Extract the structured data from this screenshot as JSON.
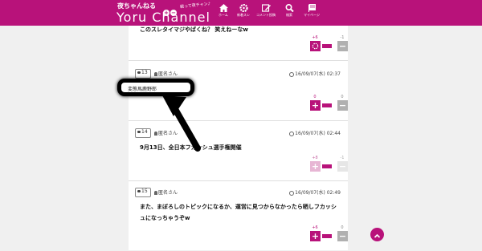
{
  "header": {
    "logo_jp": "夜ちゃんねる",
    "logo_en": "Yoru Channel",
    "logo_tag": "戦って夜チャン♪",
    "logo_plus": "+",
    "logo_minus": "−",
    "nav": [
      {
        "label": "ホーム",
        "icon": "home-icon"
      },
      {
        "label": "新着スレ",
        "icon": "gear-icon"
      },
      {
        "label": "コメント投稿",
        "icon": "pencil-icon"
      },
      {
        "label": "検索",
        "icon": "search-icon"
      },
      {
        "label": "マイページ",
        "icon": "book-icon"
      }
    ]
  },
  "posts": [
    {
      "number": "",
      "user": "",
      "date": "",
      "text": "このスレタイマジやばくね？ 笑えねーなw",
      "plus": "+6",
      "minus": "-1",
      "plus_state": "active"
    },
    {
      "number": "13",
      "user": "匿名さん",
      "date": "16/09/07(水) 02:37",
      "text": "変態馬鹿野郎",
      "plus": "0",
      "minus": "0",
      "plus_state": "normal"
    },
    {
      "number": "14",
      "user": "匿名さん",
      "date": "16/09/07(水) 02:44",
      "text": "9月13日、全日本フカッシュ選手権開催",
      "plus": "+8",
      "minus": "-1",
      "plus_state": "faded"
    },
    {
      "number": "15",
      "user": "匿名さん",
      "date": "16/09/07(水) 02:49",
      "text_line1": "また、まぼろしのトピックになるか、運営に見つからなかったら晒しフカッシ",
      "text_line2": "ュになっちゃうぞw",
      "plus": "+6",
      "minus": "0",
      "plus_state": "normal"
    }
  ],
  "scroll_top_icon": "chevron-up-icon",
  "colors": {
    "brand": "#b8127a",
    "minus_btn": "#b0b0b0"
  }
}
